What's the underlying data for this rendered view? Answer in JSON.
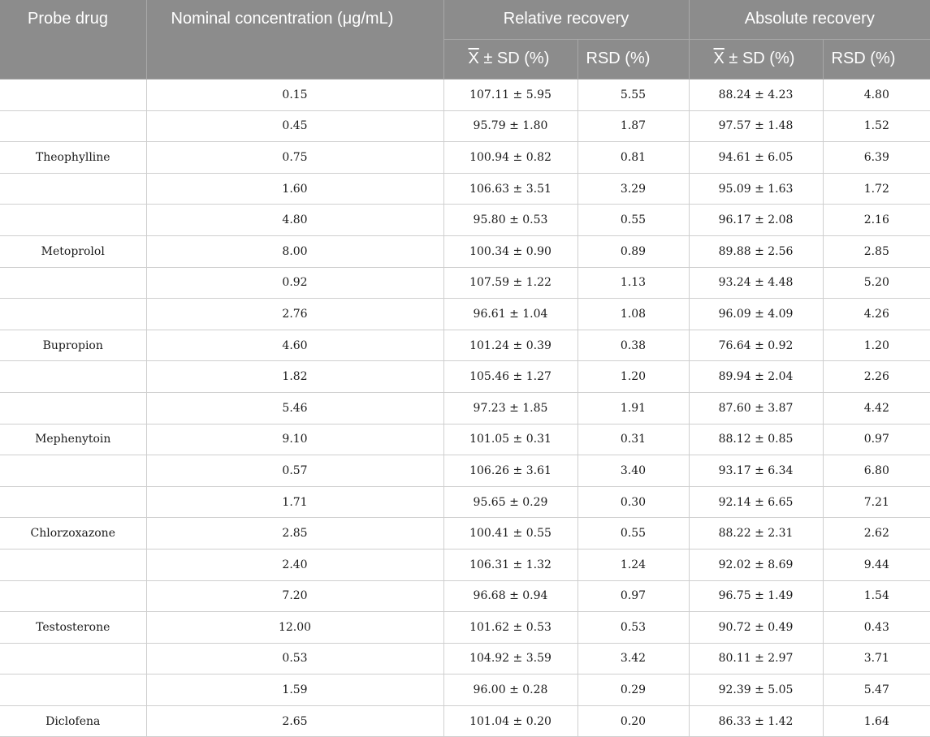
{
  "table": {
    "headers": {
      "probe_drug": "Probe drug",
      "nominal_concentration": "Nominal concentration (μg/mL)",
      "relative_recovery": "Relative recovery",
      "absolute_recovery": "Absolute recovery",
      "mean_sd": "X̄ ± SD (%)",
      "mean_sd_x": "X",
      "mean_sd_rest": " ± SD (%)",
      "rsd": "RSD (%)"
    },
    "rows": [
      {
        "probe": "",
        "conc": "0.15",
        "rel_mean": "107.11 ± 5.95",
        "rel_rsd": "5.55",
        "abs_mean": "88.24 ± 4.23",
        "abs_rsd": "4.80"
      },
      {
        "probe": "",
        "conc": "0.45",
        "rel_mean": "95.79 ± 1.80",
        "rel_rsd": "1.87",
        "abs_mean": "97.57 ± 1.48",
        "abs_rsd": "1.52"
      },
      {
        "probe": "Theophylline",
        "conc": "0.75",
        "rel_mean": "100.94 ± 0.82",
        "rel_rsd": "0.81",
        "abs_mean": "94.61 ± 6.05",
        "abs_rsd": "6.39"
      },
      {
        "probe": "",
        "conc": "1.60",
        "rel_mean": "106.63 ± 3.51",
        "rel_rsd": "3.29",
        "abs_mean": "95.09 ± 1.63",
        "abs_rsd": "1.72"
      },
      {
        "probe": "",
        "conc": "4.80",
        "rel_mean": "95.80 ± 0.53",
        "rel_rsd": "0.55",
        "abs_mean": "96.17 ± 2.08",
        "abs_rsd": "2.16"
      },
      {
        "probe": "Metoprolol",
        "conc": "8.00",
        "rel_mean": "100.34 ± 0.90",
        "rel_rsd": "0.89",
        "abs_mean": "89.88 ± 2.56",
        "abs_rsd": "2.85"
      },
      {
        "probe": "",
        "conc": "0.92",
        "rel_mean": "107.59 ± 1.22",
        "rel_rsd": "1.13",
        "abs_mean": "93.24 ± 4.48",
        "abs_rsd": "5.20"
      },
      {
        "probe": "",
        "conc": "2.76",
        "rel_mean": "96.61 ± 1.04",
        "rel_rsd": "1.08",
        "abs_mean": "96.09 ± 4.09",
        "abs_rsd": "4.26"
      },
      {
        "probe": "Bupropion",
        "conc": "4.60",
        "rel_mean": "101.24 ± 0.39",
        "rel_rsd": "0.38",
        "abs_mean": "76.64 ± 0.92",
        "abs_rsd": "1.20"
      },
      {
        "probe": "",
        "conc": "1.82",
        "rel_mean": "105.46 ± 1.27",
        "rel_rsd": "1.20",
        "abs_mean": "89.94 ± 2.04",
        "abs_rsd": "2.26"
      },
      {
        "probe": "",
        "conc": "5.46",
        "rel_mean": "97.23 ± 1.85",
        "rel_rsd": "1.91",
        "abs_mean": "87.60 ± 3.87",
        "abs_rsd": "4.42"
      },
      {
        "probe": "Mephenytoin",
        "conc": "9.10",
        "rel_mean": "101.05 ± 0.31",
        "rel_rsd": "0.31",
        "abs_mean": "88.12 ± 0.85",
        "abs_rsd": "0.97"
      },
      {
        "probe": "",
        "conc": "0.57",
        "rel_mean": "106.26 ± 3.61",
        "rel_rsd": "3.40",
        "abs_mean": "93.17 ± 6.34",
        "abs_rsd": "6.80"
      },
      {
        "probe": "",
        "conc": "1.71",
        "rel_mean": "95.65 ± 0.29",
        "rel_rsd": "0.30",
        "abs_mean": "92.14 ± 6.65",
        "abs_rsd": "7.21"
      },
      {
        "probe": "Chlorzoxazone",
        "conc": "2.85",
        "rel_mean": "100.41 ± 0.55",
        "rel_rsd": "0.55",
        "abs_mean": "88.22 ± 2.31",
        "abs_rsd": "2.62"
      },
      {
        "probe": "",
        "conc": "2.40",
        "rel_mean": "106.31 ± 1.32",
        "rel_rsd": "1.24",
        "abs_mean": "92.02 ± 8.69",
        "abs_rsd": "9.44"
      },
      {
        "probe": "",
        "conc": "7.20",
        "rel_mean": "96.68 ± 0.94",
        "rel_rsd": "0.97",
        "abs_mean": "96.75 ± 1.49",
        "abs_rsd": "1.54"
      },
      {
        "probe": "Testosterone",
        "conc": "12.00",
        "rel_mean": "101.62 ± 0.53",
        "rel_rsd": "0.53",
        "abs_mean": "90.72 ± 0.49",
        "abs_rsd": "0.43"
      },
      {
        "probe": "",
        "conc": "0.53",
        "rel_mean": "104.92 ± 3.59",
        "rel_rsd": "3.42",
        "abs_mean": "80.11 ± 2.97",
        "abs_rsd": "3.71"
      },
      {
        "probe": "",
        "conc": "1.59",
        "rel_mean": "96.00 ± 0.28",
        "rel_rsd": "0.29",
        "abs_mean": "92.39 ± 5.05",
        "abs_rsd": "5.47"
      },
      {
        "probe": "Diclofena",
        "conc": "2.65",
        "rel_mean": "101.04 ± 0.20",
        "rel_rsd": "0.20",
        "abs_mean": "86.33 ± 1.42",
        "abs_rsd": "1.64"
      }
    ]
  },
  "colors": {
    "header_bg": "#8c8c8c",
    "header_text": "#ffffff",
    "grid_line": "#cfcfcf"
  }
}
